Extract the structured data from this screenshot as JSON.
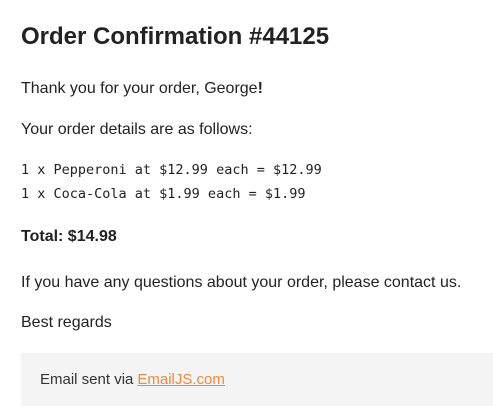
{
  "email": {
    "title": "Order Confirmation #44125",
    "greeting_prefix": "Thank you for your order, George",
    "greeting_suffix": "!",
    "details_intro": "Your order details are as follows:",
    "items": [
      "1 x Pepperoni at $12.99 each = $12.99",
      "1 x Coca-Cola at $1.99 each = $1.99"
    ],
    "total_label": "Total: $14.98",
    "questions": "If you have any questions about your order, please contact us.",
    "regards": "Best regards"
  },
  "footer": {
    "prefix": "Email sent via",
    "link_text": "EmailJS.com"
  },
  "colors": {
    "link": "#f0883e",
    "footer_bg": "#f4f4f4",
    "text": "#222222"
  }
}
